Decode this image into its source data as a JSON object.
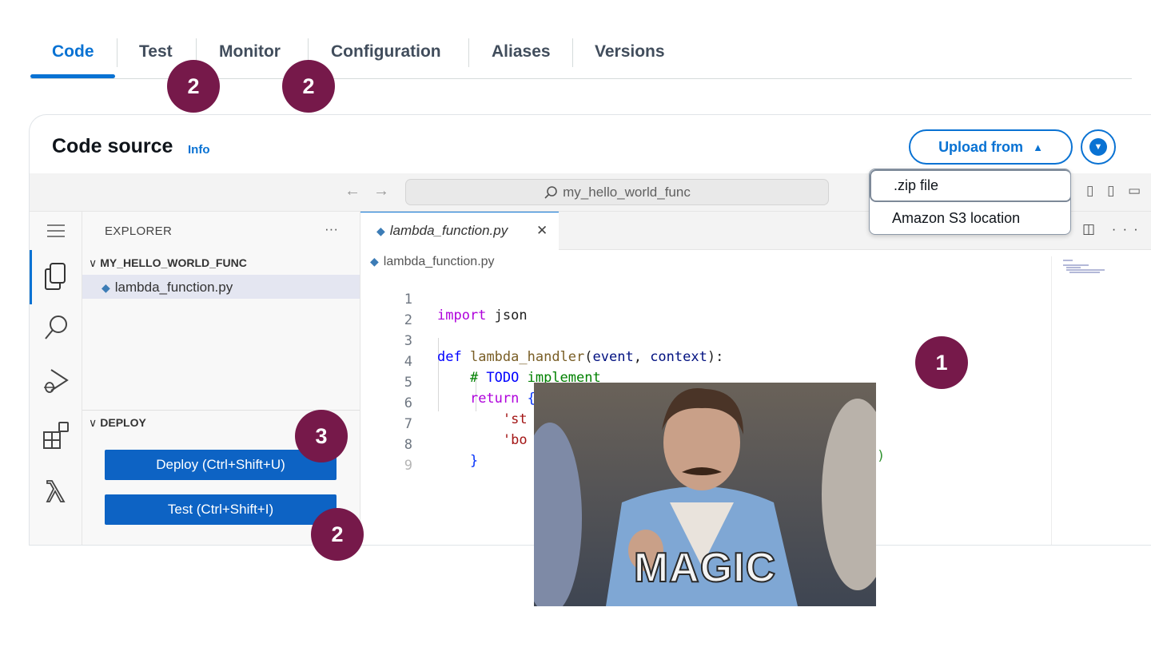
{
  "tabs": [
    {
      "label": "Code",
      "active": true
    },
    {
      "label": "Test"
    },
    {
      "label": "Monitor"
    },
    {
      "label": "Configuration"
    },
    {
      "label": "Aliases"
    },
    {
      "label": "Versions"
    }
  ],
  "code_source": {
    "title": "Code source",
    "info": "Info",
    "upload_button": "Upload from",
    "upload_arrow": "▲",
    "upload_menu": [
      ".zip file",
      "Amazon S3 location"
    ]
  },
  "ide": {
    "search_text": "my_hello_world_func",
    "explorer_title": "EXPLORER",
    "explorer_more": "···",
    "folder": "MY_HELLO_WORLD_FUNC",
    "file": "lambda_function.py",
    "deploy_section": "DEPLOY",
    "deploy_button": "Deploy (Ctrl+Shift+U)",
    "test_button": "Test (Ctrl+Shift+I)",
    "editor_tab": "lambda_function.py",
    "breadcrumb": "lambda_function.py",
    "icons": [
      "menu-icon",
      "files-icon",
      "search-icon",
      "run-debug-icon",
      "extensions-icon",
      "lambda-icon"
    ]
  },
  "code_lines": [
    {
      "n": "1",
      "text": "import json"
    },
    {
      "n": "2",
      "text": ""
    },
    {
      "n": "3",
      "text": "def lambda_handler(event, context):"
    },
    {
      "n": "4",
      "text": "    # TODO implement"
    },
    {
      "n": "5",
      "text": "    return {"
    },
    {
      "n": "6",
      "text": "        'st"
    },
    {
      "n": "7",
      "text": "        'bo"
    },
    {
      "n": "8",
      "text": "    }"
    },
    {
      "n": "9",
      "text": ""
    }
  ],
  "code_tail": ")",
  "annotations": [
    "2",
    "2",
    "3",
    "2",
    "1"
  ],
  "overlay_caption": "MAGIC",
  "colors": {
    "accent": "#0972d3",
    "badge": "#76194a",
    "button": "#0d63c4",
    "keyword": "#af00db",
    "keyword_def": "#0000ff",
    "function_name": "#795e26",
    "parameter": "#001080",
    "comment": "#008000",
    "string": "#a31515"
  }
}
